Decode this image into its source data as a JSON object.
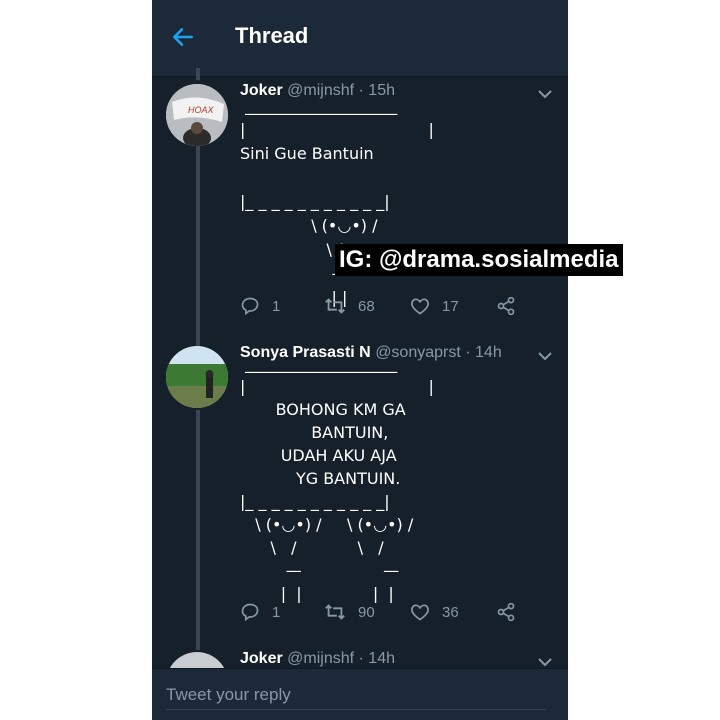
{
  "header": {
    "title": "Thread",
    "back_icon": "arrow-left-icon"
  },
  "tweets": [
    {
      "name": "Joker",
      "handle": "@mijnshf · 15h",
      "body": " ___________________\n|                                    |\nSini Gue Bantuin\n\n|_ _ _ _ _ _ _ _ _ _ _|\n              \\ (•◡•) /\n                 \\ /\n                  —\n                  | |",
      "replies": "1",
      "retweets": "68",
      "likes": "17"
    },
    {
      "name": "Sonya Prasasti N",
      "handle": "@sonyaprst · 14h",
      "body": " ___________________\n|                                    |\n       BOHONG KM GA\n              BANTUIN,\n        UDAH AKU AJA\n           YG BANTUIN.\n|_ _ _ _ _ _ _ _ _ _ _|\n   \\ (•◡•) /     \\ (•◡•) /\n      \\   /            \\   /\n         —                —\n        |  |              |  |",
      "replies": "1",
      "retweets": "90",
      "likes": "36"
    },
    {
      "name": "Joker",
      "handle": "@mijnshf · 14h"
    }
  ],
  "watermark": "IG: @drama.sosialmedia",
  "reply": {
    "placeholder": "Tweet your reply"
  },
  "colors": {
    "background": "#15202b",
    "bar": "#1c2938",
    "accent": "#1da1f2",
    "muted": "#8899a6"
  }
}
